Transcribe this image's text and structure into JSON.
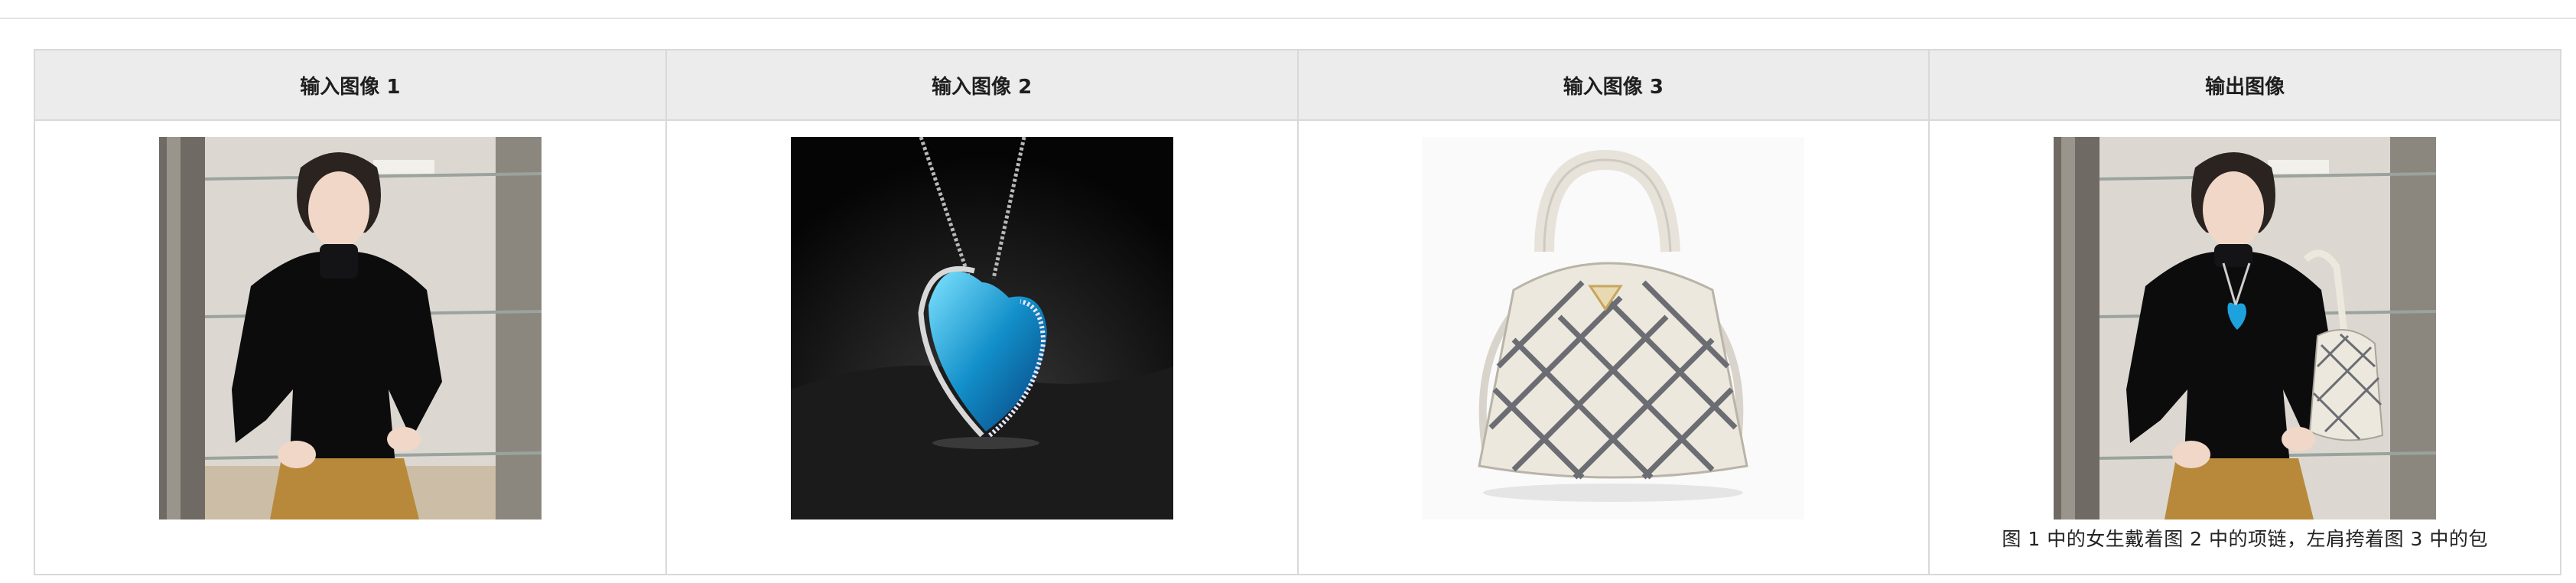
{
  "table": {
    "headers": [
      "输入图像 1",
      "输入图像 2",
      "输入图像 3",
      "输出图像"
    ],
    "caption": "图 1 中的女生戴着图 2 中的项链，左肩挎着图 3 中的包"
  },
  "images": {
    "input1": "woman-in-black-turtleneck",
    "input2": "blue-heart-pendant-necklace",
    "input3": "cream-quilted-handbag",
    "output": "woman-with-necklace-and-handbag"
  }
}
